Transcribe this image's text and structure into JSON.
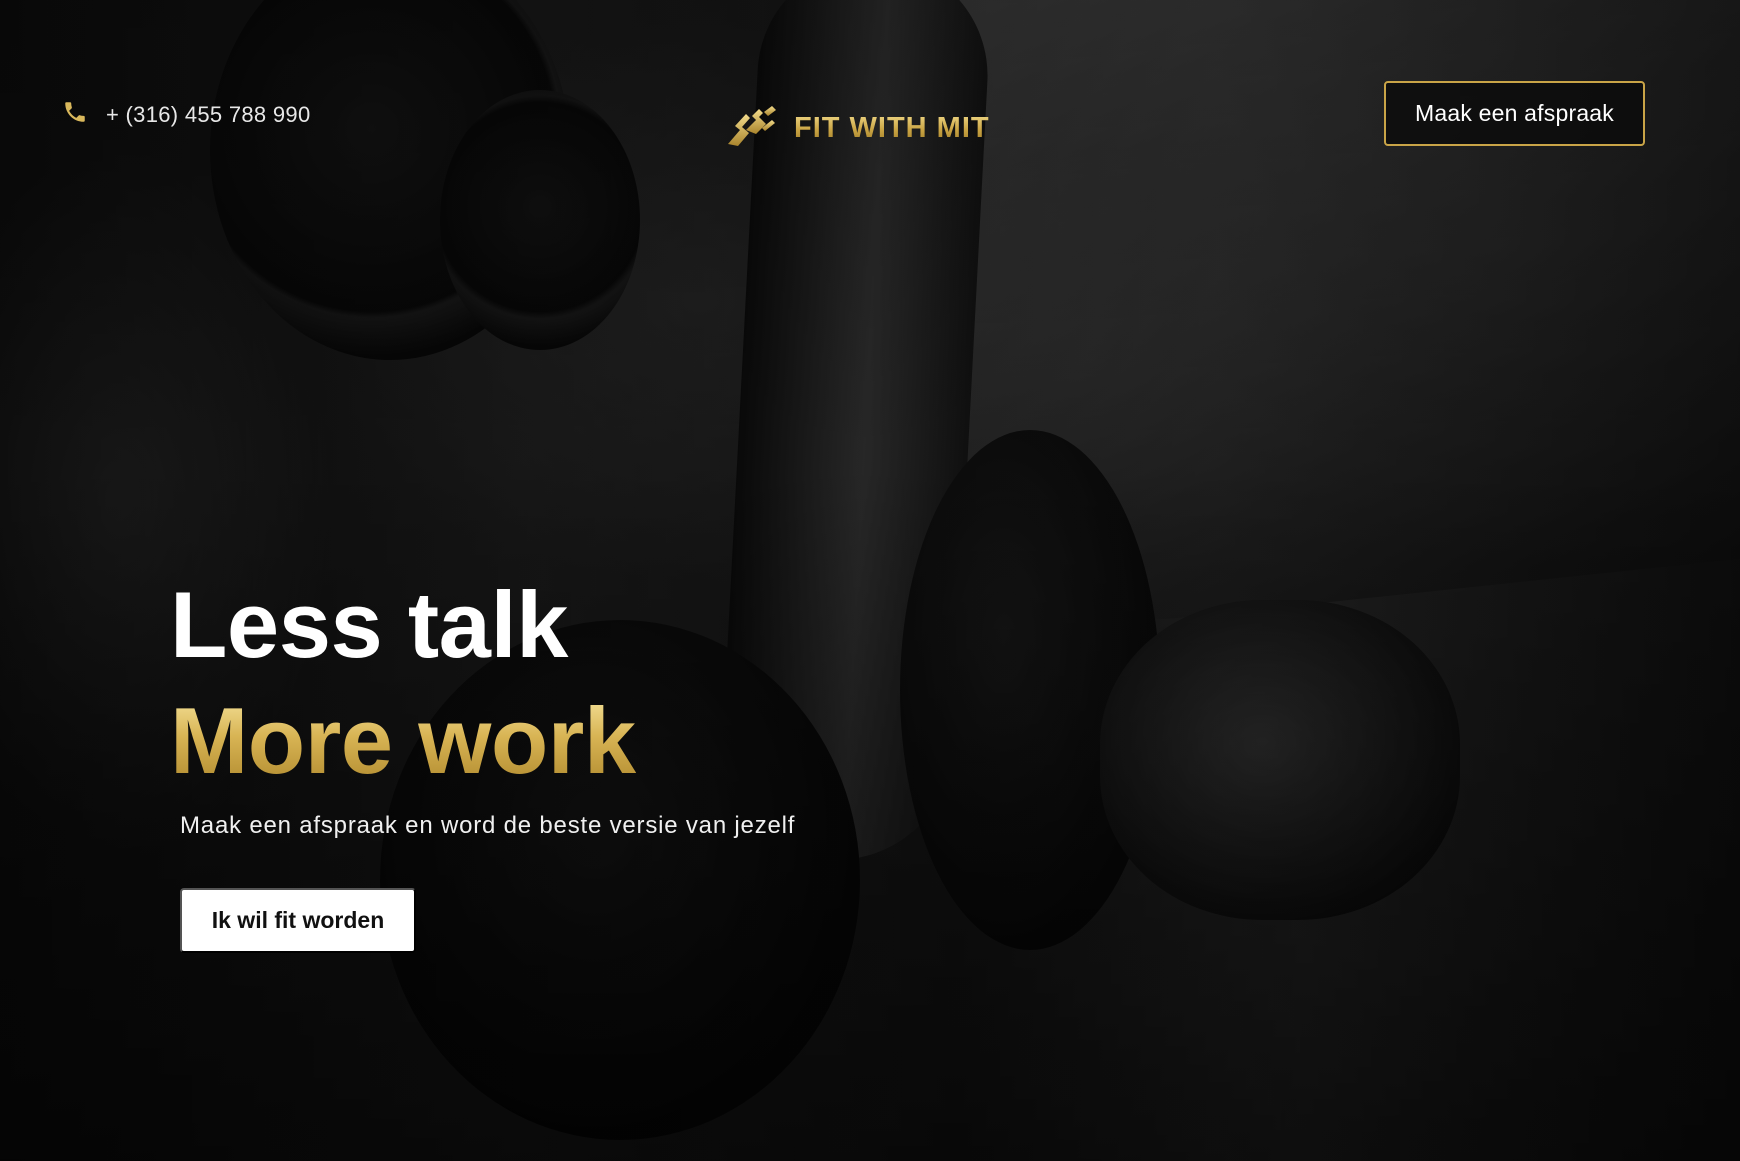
{
  "header": {
    "phone_icon": "phone-icon",
    "phone_number": "+ (316) 455 788 990",
    "logo_icon": "running-figure-logo",
    "brand_name": "FIT WITH MIT",
    "cta_label": "Maak een afspraak"
  },
  "hero": {
    "headline_line1": "Less talk",
    "headline_line2": "More work",
    "subtitle": "Maak een afspraak en word de beste versie van jezelf",
    "cta_label": "Ik wil fit worden"
  },
  "colors": {
    "accent_gold": "#c9a447",
    "text_white": "#ffffff",
    "background": "#0d0d0d"
  }
}
